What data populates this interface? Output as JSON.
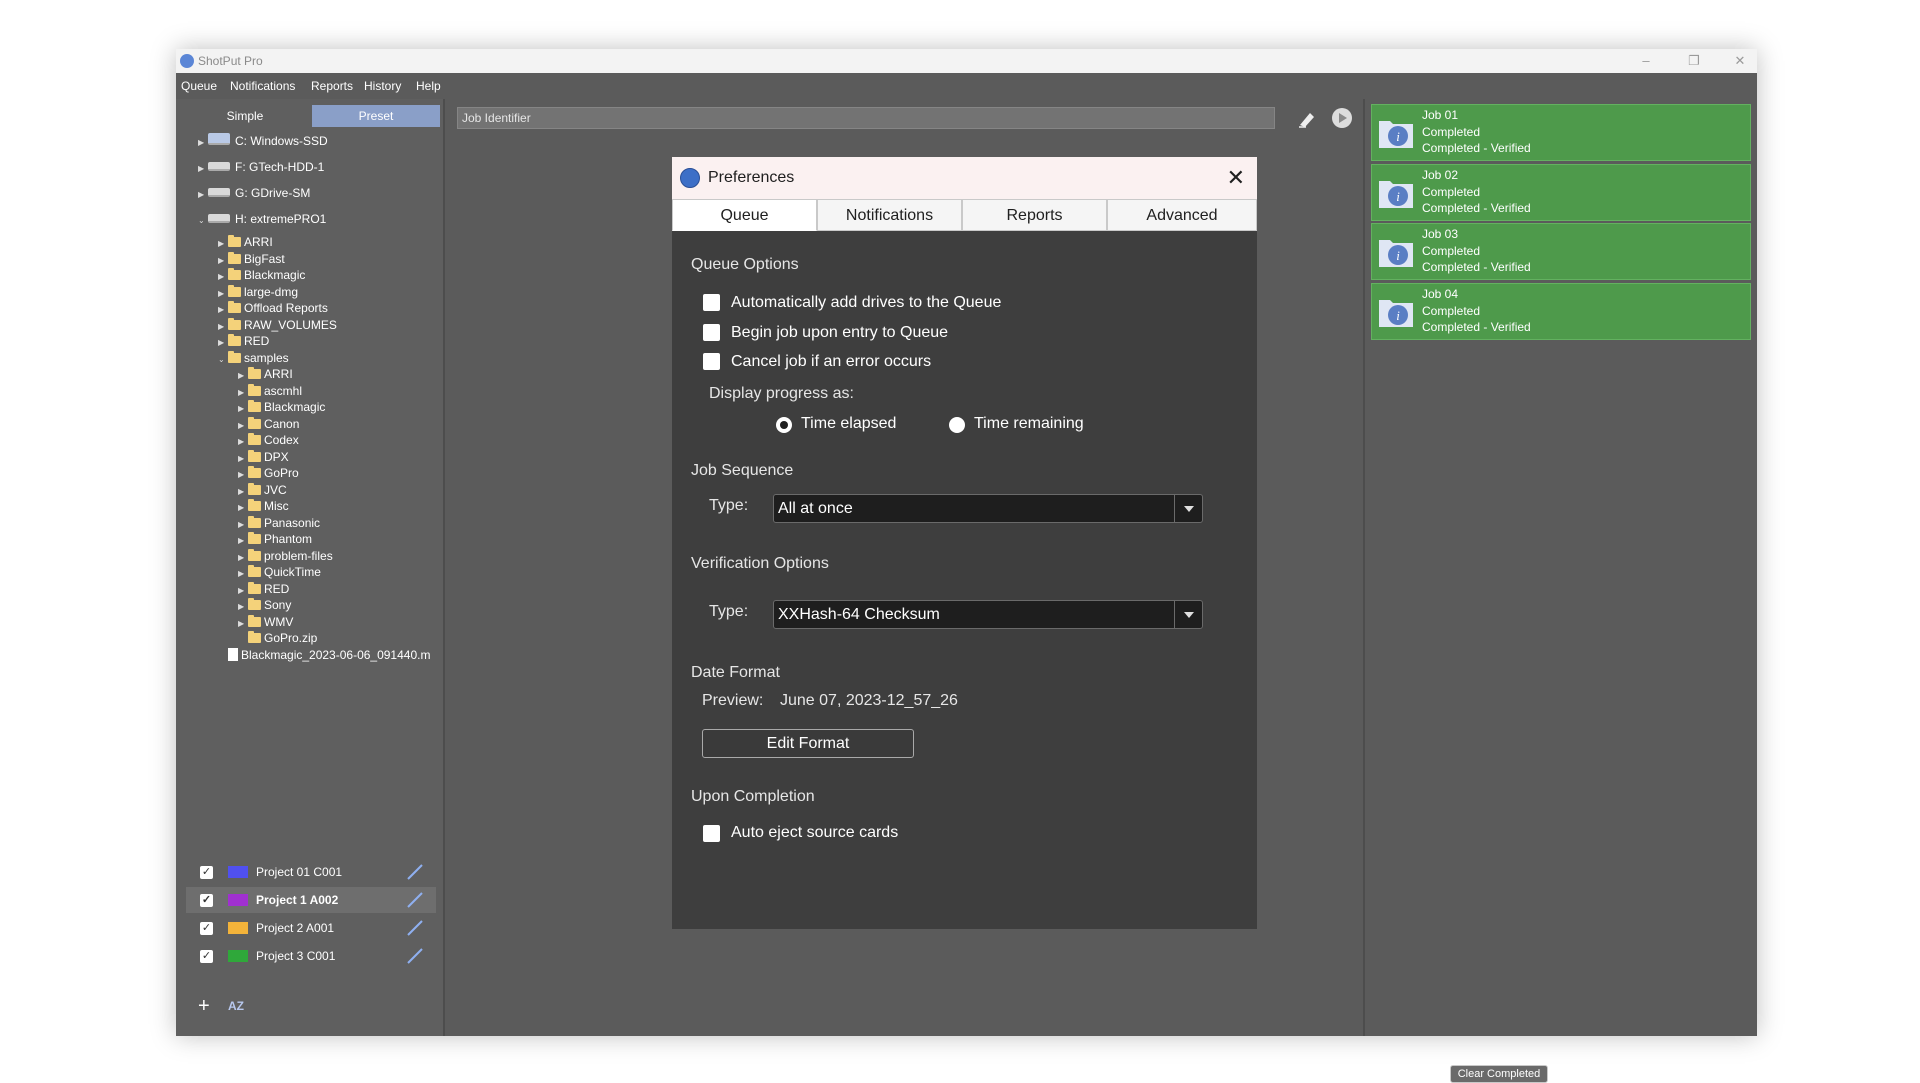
{
  "window": {
    "title": "ShotPut Pro"
  },
  "menu": [
    "Queue",
    "Notifications",
    "Reports",
    "History",
    "Help"
  ],
  "left": {
    "mode_tabs": [
      "Simple",
      "Preset"
    ],
    "drives": [
      "C: Windows-SSD",
      "F: GTech-HDD-1",
      "G: GDrive-SM",
      "H: extremePRO1"
    ],
    "h_folders": [
      "ARRI",
      "BigFast",
      "Blackmagic",
      "large-dmg",
      "Offload Reports",
      "RAW_VOLUMES",
      "RED",
      "samples"
    ],
    "sample_folders": [
      "ARRI",
      "ascmhl",
      "Blackmagic",
      "Canon",
      "Codex",
      "DPX",
      "GoPro",
      "JVC",
      "Misc",
      "Panasonic",
      "Phantom",
      "problem-files",
      "QuickTime",
      "RED",
      "Sony",
      "WMV",
      "GoPro.zip"
    ],
    "file": "Blackmagic_2023-06-06_091440.m",
    "projects": [
      {
        "label": "Project 01 C001",
        "color": "#5050f0"
      },
      {
        "label": "Project 1 A002",
        "color": "#a030d0"
      },
      {
        "label": "Project 2 A001",
        "color": "#f3b33a"
      },
      {
        "label": "Project 3 C001",
        "color": "#2fa83a"
      }
    ],
    "sort_icon": "AZ"
  },
  "center": {
    "job_identifier_placeholder": "Job Identifier"
  },
  "jobs": [
    {
      "name": "Job 01",
      "status": "Completed",
      "detail": "Completed - Verified"
    },
    {
      "name": "Job 02",
      "status": "Completed",
      "detail": "Completed - Verified"
    },
    {
      "name": "Job 03",
      "status": "Completed",
      "detail": "Completed - Verified"
    },
    {
      "name": "Job 04",
      "status": "Completed",
      "detail": "Completed - Verified"
    }
  ],
  "clear_completed": "Clear Completed",
  "prefs": {
    "title": "Preferences",
    "tabs": [
      "Queue",
      "Notifications",
      "Reports",
      "Advanced"
    ],
    "queue_options": {
      "title": "Queue Options",
      "auto_add": "Automatically add drives to the Queue",
      "begin_job": "Begin job upon entry to Queue",
      "cancel_job": "Cancel job if an error occurs",
      "display_progress": "Display progress as:",
      "time_elapsed": "Time elapsed",
      "time_remaining": "Time remaining",
      "selected_progress": "Time elapsed"
    },
    "job_sequence": {
      "title": "Job Sequence",
      "type_label": "Type:",
      "value": "All at once"
    },
    "verification": {
      "title": "Verification Options",
      "type_label": "Type:",
      "value": "XXHash-64 Checksum"
    },
    "date_format": {
      "title": "Date Format",
      "preview_label": "Preview:",
      "preview_value": "June 07, 2023-12_57_26",
      "edit_button": "Edit Format"
    },
    "completion": {
      "title": "Upon Completion",
      "auto_eject": "Auto eject source cards"
    }
  }
}
